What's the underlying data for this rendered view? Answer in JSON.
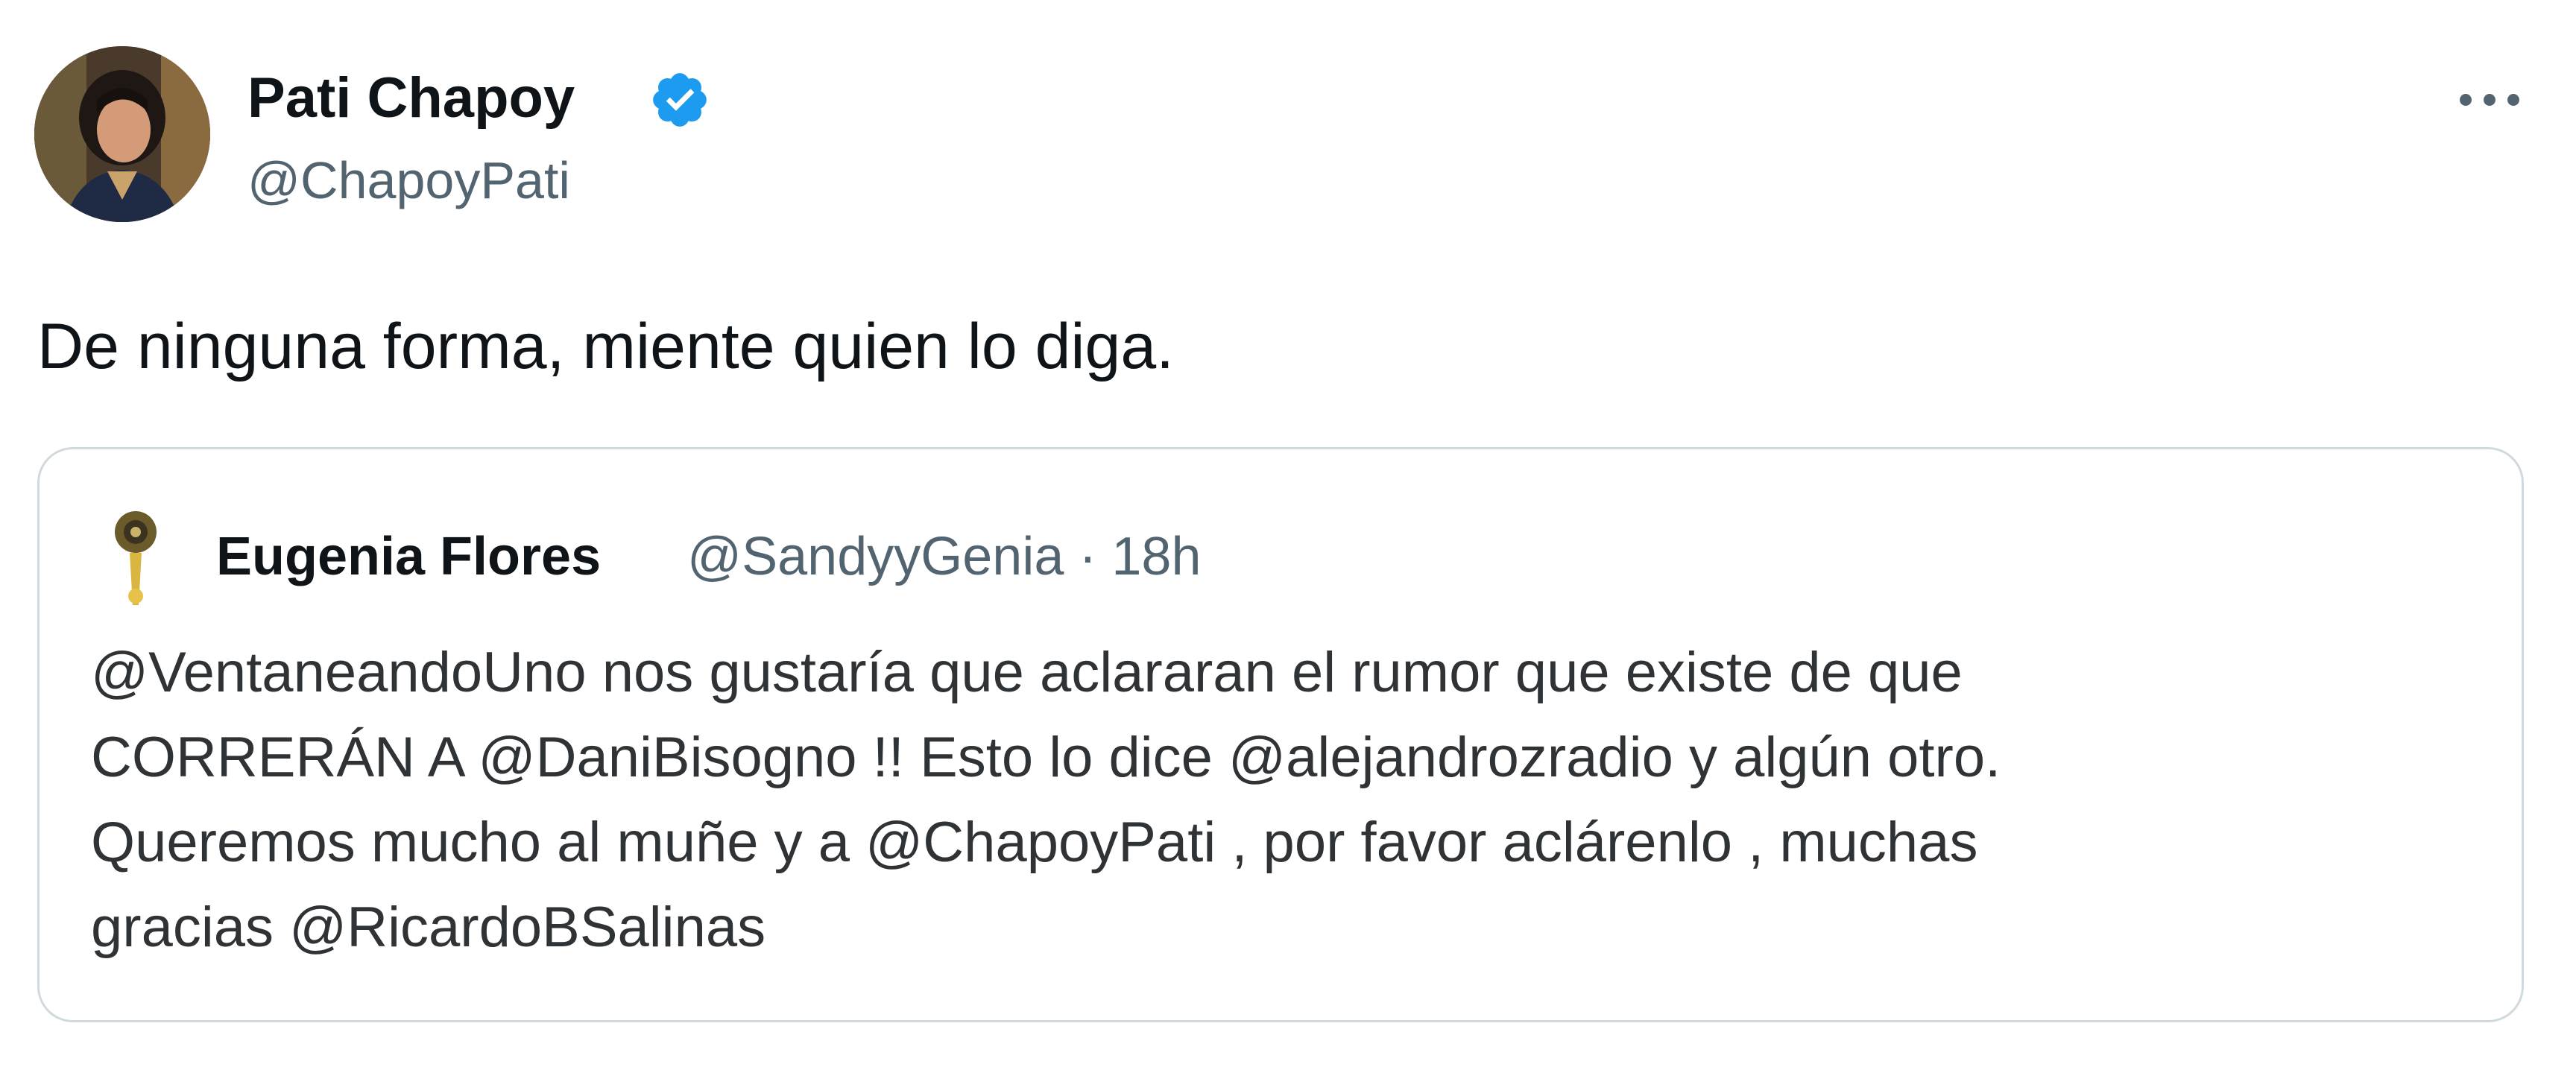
{
  "tweet": {
    "author_name": "Pati Chapoy",
    "author_handle": "@ChapoyPati",
    "verified_icon": "verified-badge-icon",
    "more_icon": "more-options-icon",
    "text": "De ninguna forma, miente quien lo diga."
  },
  "quote": {
    "author_name": "Eugenia Flores",
    "author_handle": "@SandyyGenia",
    "separator": "·",
    "time": "18h",
    "lines": [
      "@VentaneandoUno nos gustaría que aclararan el rumor que existe de que",
      "CORRERÁN A @DaniBisogno !! Esto lo dice @alejandrozradio y algún otro.",
      "Queremos mucho al muñe y a @ChapoyPati , por favor aclárenlo , muchas",
      "gracias @RicardoBSalinas"
    ]
  },
  "colors": {
    "text_primary": "#0f1419",
    "text_secondary": "#536471",
    "verified_blue": "#1d9bf0",
    "border": "#cfd9de"
  }
}
